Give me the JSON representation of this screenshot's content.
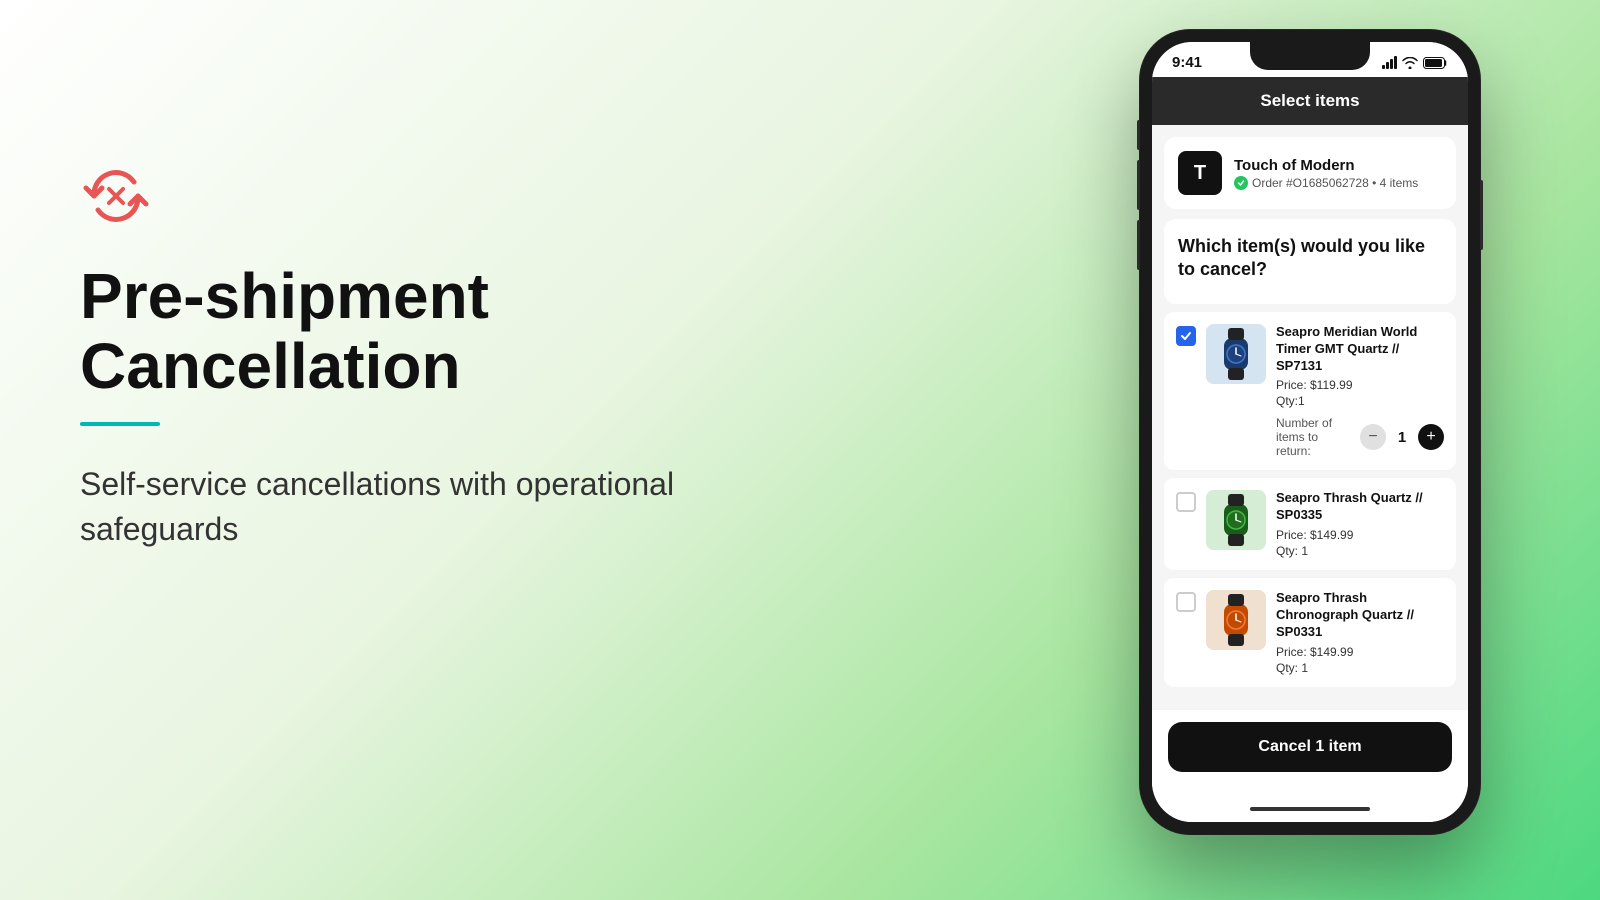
{
  "background": {
    "gradient_start": "#ffffff",
    "gradient_end": "#4dd880"
  },
  "left": {
    "icon_label": "pre-shipment-cancel-icon",
    "title": "Pre-shipment Cancellation",
    "teal_line": true,
    "subtitle": "Self-service cancellations with operational safeguards"
  },
  "phone": {
    "status_bar": {
      "time": "9:41",
      "signal": true,
      "wifi": true,
      "battery": true
    },
    "header": {
      "title": "Select items"
    },
    "merchant": {
      "logo_letter": "T",
      "name": "Touch of Modern",
      "order": "Order #O1685062728 • 4 items"
    },
    "question": "Which item(s) would you like to cancel?",
    "items": [
      {
        "id": "item-1",
        "checked": true,
        "name": "Seapro Meridian World Timer GMT Quartz // SP7131",
        "price": "Price: $119.99",
        "qty": "Qty:1",
        "qty_control": true,
        "qty_value": 1,
        "qty_label": "Number of items to return:"
      },
      {
        "id": "item-2",
        "checked": false,
        "name": "Seapro Thrash Quartz // SP0335",
        "price": "Price: $149.99",
        "qty": "Qty: 1",
        "qty_control": false
      },
      {
        "id": "item-3",
        "checked": false,
        "name": "Seapro Thrash Chronograph Quartz // SP0331",
        "price": "Price: $149.99",
        "qty": "Qty: 1",
        "qty_control": false
      }
    ],
    "cancel_button": "Cancel 1 item"
  }
}
